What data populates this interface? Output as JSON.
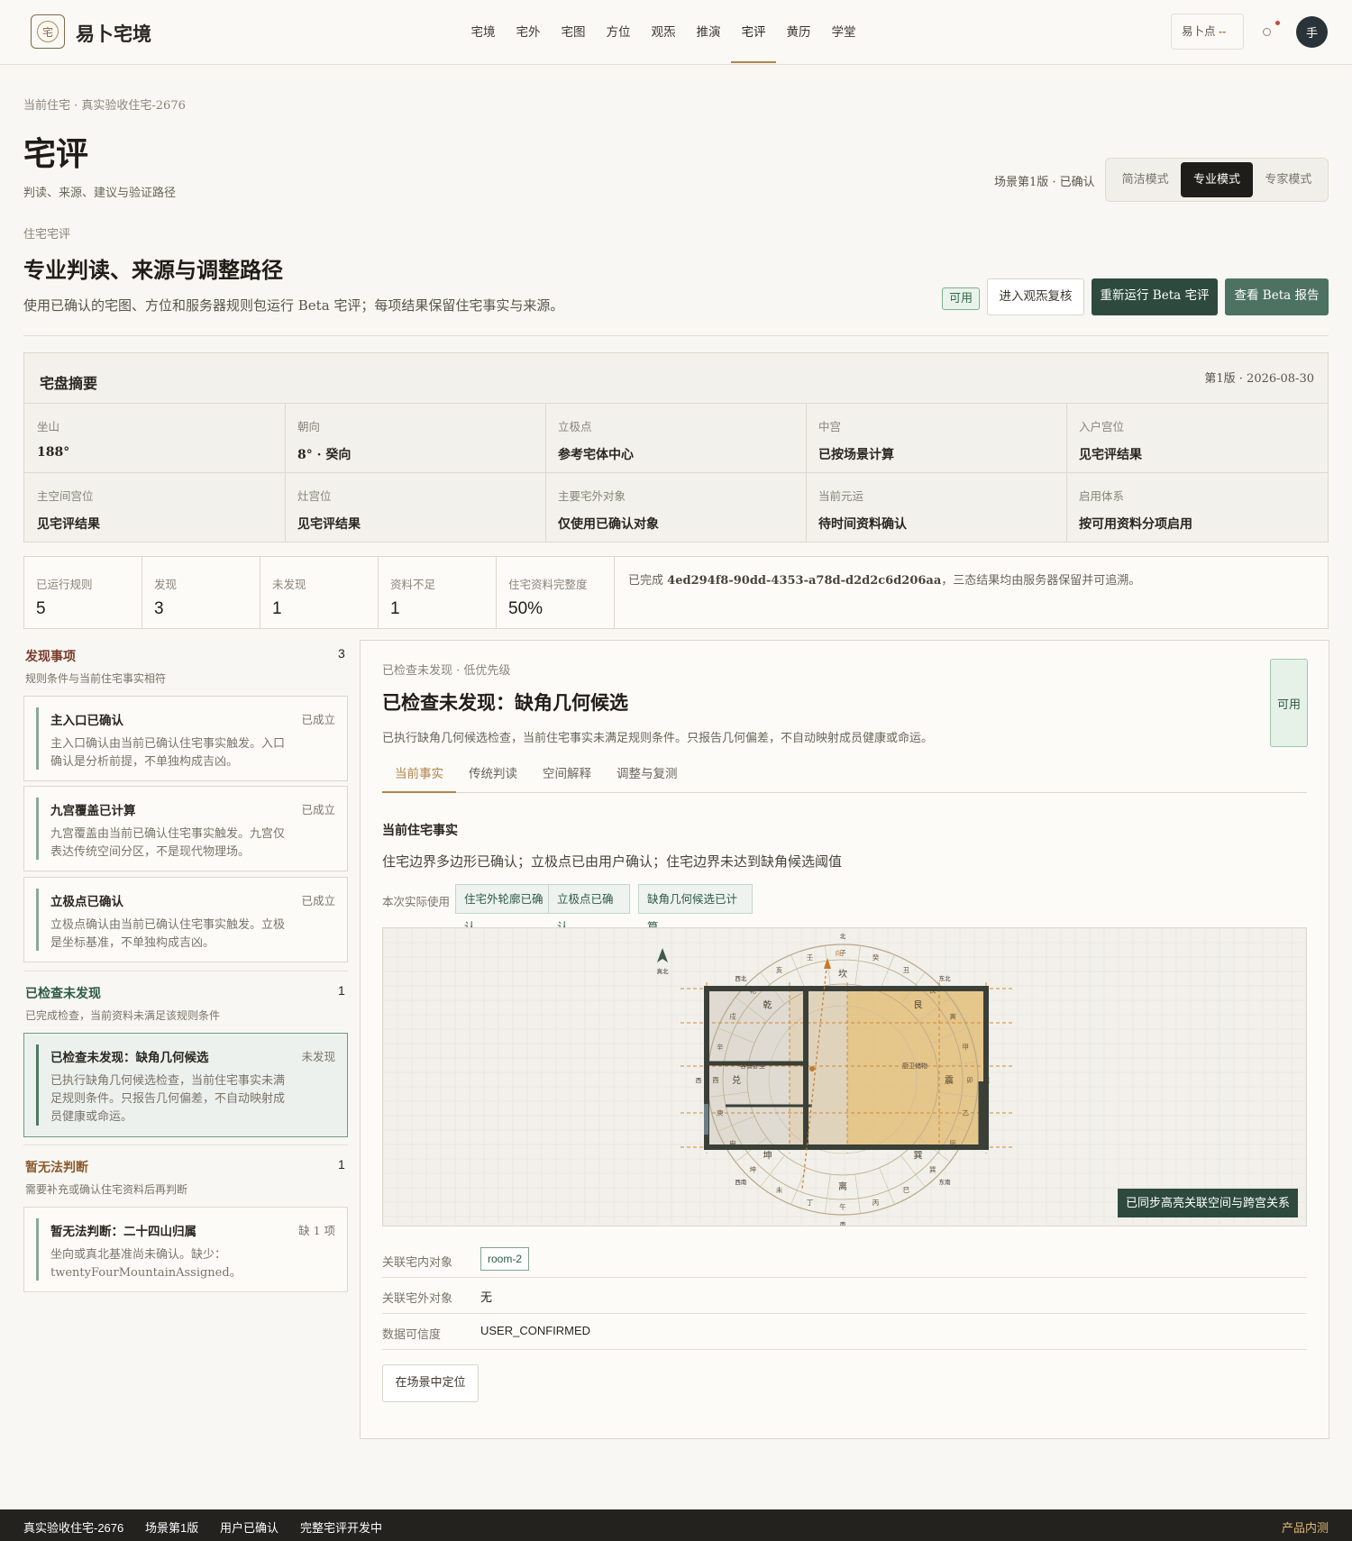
{
  "header": {
    "logo_char": "宅",
    "brand": "易卜宅境",
    "nav": [
      "宅境",
      "宅外",
      "宅图",
      "方位",
      "观炁",
      "推演",
      "宅评",
      "黄历",
      "学堂"
    ],
    "active_nav": "宅评",
    "points_label": "易卜点",
    "points_value": "--",
    "avatar": "手"
  },
  "page": {
    "breadcrumb": "当前住宅 · 真实验收住宅-2676",
    "title": "宅评",
    "subtitle": "判读、来源、建议与验证路径",
    "scene_status": "场景第1版 · 已确认",
    "modes": [
      "简洁模式",
      "专业模式",
      "专家模式"
    ],
    "active_mode": "专业模式"
  },
  "section": {
    "label": "住宅宅评",
    "title": "专业判读、来源与调整路径",
    "desc": "使用已确认的宅图、方位和服务器规则包运行 Beta 宅评；每项结果保留住宅事实与来源。",
    "status": "可用",
    "btn_review": "进入观炁复核",
    "btn_rerun": "重新运行 Beta 宅评",
    "btn_report": "查看 Beta 报告"
  },
  "summary": {
    "title": "宅盘摘要",
    "version": "第1版 · 2026-08-30",
    "cells": [
      {
        "k": "坐山",
        "v": "188°"
      },
      {
        "k": "朝向",
        "v": "8° · 癸向"
      },
      {
        "k": "立极点",
        "v": "参考宅体中心"
      },
      {
        "k": "中宫",
        "v": "已按场景计算"
      },
      {
        "k": "入户宫位",
        "v": "见宅评结果"
      },
      {
        "k": "主空间宫位",
        "v": "见宅评结果"
      },
      {
        "k": "灶宫位",
        "v": "见宅评结果"
      },
      {
        "k": "主要宅外对象",
        "v": "仅使用已确认对象"
      },
      {
        "k": "当前元运",
        "v": "待时间资料确认"
      },
      {
        "k": "启用体系",
        "v": "按可用资料分项启用"
      }
    ]
  },
  "stats": {
    "items": [
      {
        "k": "已运行规则",
        "v": "5"
      },
      {
        "k": "发现",
        "v": "3"
      },
      {
        "k": "未发现",
        "v": "1"
      },
      {
        "k": "资料不足",
        "v": "1"
      },
      {
        "k": "住宅资料完整度",
        "v": "50%"
      }
    ],
    "note_prefix": "已完成",
    "note_id": "4ed294f8-90dd-4353-a78d-d2d2c6d206aa",
    "note_suffix": "，三态结果均由服务器保留并可追溯。"
  },
  "groups": {
    "found": {
      "title": "发现事项",
      "count": "3",
      "desc": "规则条件与当前住宅事实相符",
      "cards": [
        {
          "t": "主入口已确认",
          "s": "已成立",
          "d": "主入口确认由当前已确认住宅事实触发。入口确认是分析前提，不单独构成吉凶。"
        },
        {
          "t": "九宫覆盖已计算",
          "s": "已成立",
          "d": "九宫覆盖由当前已确认住宅事实触发。九宫仅表达传统空间分区，不是现代物理场。"
        },
        {
          "t": "立极点已确认",
          "s": "已成立",
          "d": "立极点确认由当前已确认住宅事实触发。立极是坐标基准，不单独构成吉凶。"
        }
      ]
    },
    "notfound": {
      "title": "已检查未发现",
      "count": "1",
      "desc": "已完成检查，当前资料未满足该规则条件",
      "cards": [
        {
          "t": "已检查未发现：缺角几何候选",
          "s": "未发现",
          "d": "已执行缺角几何候选检查，当前住宅事实未满足规则条件。只报告几何偏差，不自动映射成员健康或命运。"
        }
      ]
    },
    "undetermined": {
      "title": "暂无法判断",
      "count": "1",
      "desc": "需要补充或确认住宅资料后再判断",
      "cards": [
        {
          "t": "暂无法判断：二十四山归属",
          "s": "缺 1 项",
          "d": "坐向或真北基准尚未确认。缺少：twentyFourMountainAssigned。"
        }
      ]
    }
  },
  "detail": {
    "label": "已检查未发现 · 低优先级",
    "title": "已检查未发现：缺角几何候选",
    "desc": "已执行缺角几何候选检查，当前住宅事实未满足规则条件。只报告几何偏差，不自动映射成员健康或命运。",
    "status": "可用",
    "tabs": [
      "当前事实",
      "传统判读",
      "空间解释",
      "调整与复测"
    ],
    "active_tab": "当前事实",
    "fact_heading": "当前住宅事实",
    "fact_text": "住宅边界多边形已确认；立极点已由用户确认；住宅边界未达到缺角候选阈值",
    "used_label": "本次实际使用",
    "chips": [
      "住宅外轮廓已确认",
      "立极点已确认",
      "缺角几何候选已计算"
    ],
    "sync_label": "已同步高亮关联空间与跨宫关系",
    "rows": [
      {
        "k": "关联宅内对象",
        "v": "room-2"
      },
      {
        "k": "关联宅外对象",
        "v": "无"
      },
      {
        "k": "数据可信度",
        "v": "USER_CONFIRMED"
      }
    ],
    "locate_btn": "在场景中定位"
  },
  "compass": {
    "north_label": "真北",
    "dirs": [
      "北",
      "东北",
      "东",
      "东南",
      "南",
      "西南",
      "西",
      "西北"
    ],
    "trigrams": [
      "坎",
      "艮",
      "震",
      "巽",
      "离",
      "坤",
      "兑",
      "乾"
    ],
    "mountains": [
      "子",
      "癸",
      "丑",
      "艮",
      "寅",
      "甲",
      "卯",
      "乙",
      "辰",
      "巽",
      "巳",
      "丙",
      "午",
      "丁",
      "未",
      "坤",
      "申",
      "庚",
      "酉",
      "辛",
      "戌",
      "乾",
      "亥",
      "壬"
    ],
    "room_label_left": "客餐卧室",
    "room_label_right": "厨卫储物",
    "facing_label": "向"
  },
  "footer": {
    "items": [
      "真实验收住宅-2676",
      "场景第1版",
      "用户已确认",
      "完整宅评开发中"
    ],
    "right": "产品内测"
  },
  "colors": {
    "accent": "#b0854a",
    "primary_dark": "#2e4a3e",
    "success": "#2e6b45"
  }
}
